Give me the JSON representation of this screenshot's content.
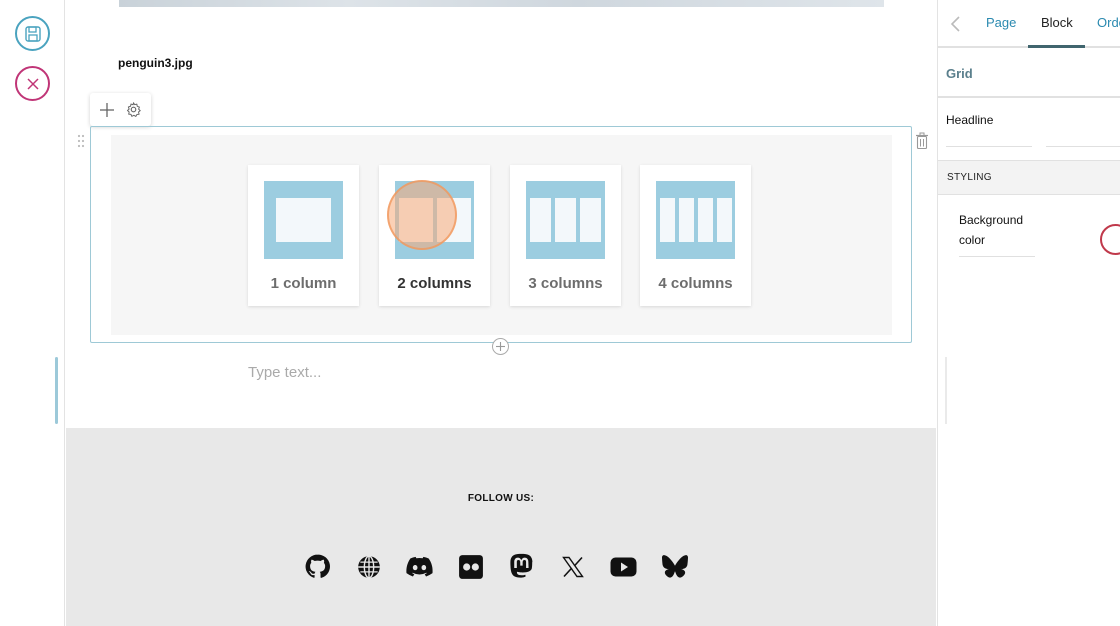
{
  "left_toolbar": {
    "save_icon": "floppy-disk-icon",
    "cancel_icon": "close-circle-icon",
    "save_color": "#4aa3bf",
    "cancel_color": "#c03577"
  },
  "canvas": {
    "image_caption": "penguin3.jpg",
    "block_toolbar": {
      "add_icon": "plus-icon",
      "settings_icon": "gear-icon"
    },
    "grid_chooser": {
      "options": [
        {
          "label": "1 column",
          "columns": 1
        },
        {
          "label": "2 columns",
          "columns": 2
        },
        {
          "label": "3 columns",
          "columns": 3
        },
        {
          "label": "4 columns",
          "columns": 4
        }
      ],
      "hovered": "2 columns"
    },
    "text_placeholder": "Type text...",
    "footer": {
      "follow_us": "FOLLOW US:",
      "social_icons": [
        "github-icon",
        "globe-icon",
        "discord-icon",
        "flickr-icon",
        "mastodon-icon",
        "x-icon",
        "youtube-icon",
        "bluesky-icon"
      ]
    }
  },
  "sidebar": {
    "tabs": [
      {
        "label": "Page",
        "active": false
      },
      {
        "label": "Block",
        "active": true
      },
      {
        "label": "Order",
        "active": false
      }
    ],
    "section_title": "Grid",
    "headline_label": "Headline",
    "styling_header": "STYLING",
    "background_color_label": "Background color"
  },
  "colors": {
    "accent": "#2b8ab0",
    "thumb": "#9ccde0",
    "footer_bg": "#e8e8e8",
    "swatch_border": "#c0394b"
  }
}
